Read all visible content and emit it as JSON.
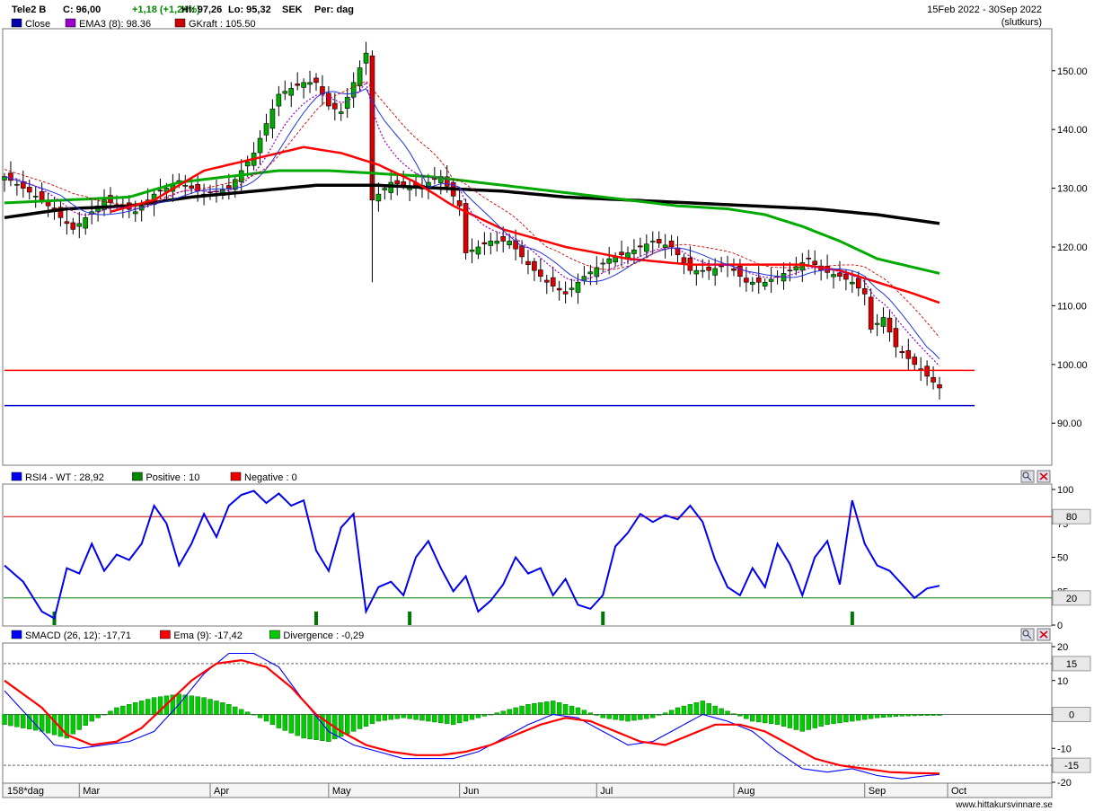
{
  "header": {
    "ticker": "Tele2 B",
    "close_label": "C: 96,00",
    "change": "+1,18 (+1,24%)",
    "high_label": "Hi: 97,26",
    "low_label": "Lo: 95,32",
    "currency": "SEK",
    "period": "Per: dag",
    "date_range": "15Feb 2022 - 30Sep 2022",
    "price_type": "(slutkurs)"
  },
  "colors": {
    "close": "#0000aa",
    "ema3": "#9900cc",
    "gkraft": "#cc0000",
    "up_candle": "#00aa00",
    "down_candle": "#dd0000",
    "ma_red": "#ff0000",
    "ma_green": "#00aa00",
    "ma_black": "#000000",
    "rsi": "#0000ee",
    "smacd": "#0000ff",
    "ema9": "#ff0000",
    "divergence": "#00cc00"
  },
  "footer": {
    "period_label": "158*dag",
    "website": "www.hittakursvinnare.se"
  },
  "chart_data": [
    {
      "type": "candlestick",
      "legend": [
        {
          "name": "Close",
          "color": "#0000aa"
        },
        {
          "name": "EMA3 (8): 98.36",
          "color": "#9900cc"
        },
        {
          "name": "GKraft : 105.50",
          "color": "#cc0000"
        }
      ],
      "x_ticks": [
        "Mar",
        "Apr",
        "May",
        "Jun",
        "Jul",
        "Aug",
        "Sep",
        "Oct"
      ],
      "y_ticks": [
        "90.00",
        "100.00",
        "110.00",
        "120.00",
        "130.00",
        "140.00",
        "150.00"
      ],
      "ylim": [
        83,
        157
      ],
      "grid": false,
      "horizontal_lines": [
        {
          "value": 99,
          "color": "#ff0000"
        },
        {
          "value": 93,
          "color": "#0000cc"
        }
      ],
      "close_anchors": [
        [
          0,
          132
        ],
        [
          6,
          128
        ],
        [
          11,
          123
        ],
        [
          16,
          128
        ],
        [
          21,
          126
        ],
        [
          24,
          129
        ],
        [
          28,
          131
        ],
        [
          32,
          129
        ],
        [
          36,
          130
        ],
        [
          40,
          136
        ],
        [
          44,
          146
        ],
        [
          48,
          148
        ],
        [
          50,
          148
        ],
        [
          52,
          144
        ],
        [
          54,
          143
        ],
        [
          56,
          148
        ],
        [
          58,
          153
        ],
        [
          59,
          128
        ],
        [
          62,
          131
        ],
        [
          66,
          130
        ],
        [
          70,
          132
        ],
        [
          73,
          127
        ],
        [
          74,
          119
        ],
        [
          78,
          121
        ],
        [
          81,
          121
        ],
        [
          84,
          117
        ],
        [
          87,
          114
        ],
        [
          90,
          112
        ],
        [
          93,
          115
        ],
        [
          97,
          118
        ],
        [
          100,
          119
        ],
        [
          104,
          121
        ],
        [
          107,
          120
        ],
        [
          110,
          116
        ],
        [
          113,
          116
        ],
        [
          116,
          117
        ],
        [
          119,
          114
        ],
        [
          122,
          114
        ],
        [
          126,
          116
        ],
        [
          129,
          118
        ],
        [
          131,
          116
        ],
        [
          134,
          115
        ],
        [
          136,
          114
        ],
        [
          138,
          112
        ],
        [
          139,
          106
        ],
        [
          141,
          108
        ],
        [
          143,
          103
        ],
        [
          145,
          101
        ],
        [
          147,
          99
        ],
        [
          149,
          97
        ],
        [
          150,
          96
        ]
      ],
      "ma_red": [
        [
          17,
          126
        ],
        [
          24,
          128
        ],
        [
          32,
          133
        ],
        [
          40,
          135
        ],
        [
          48,
          137
        ],
        [
          54,
          136
        ],
        [
          60,
          134
        ],
        [
          66,
          131
        ],
        [
          72,
          127
        ],
        [
          80,
          123
        ],
        [
          90,
          120
        ],
        [
          100,
          118
        ],
        [
          110,
          117
        ],
        [
          120,
          117
        ],
        [
          128,
          117
        ],
        [
          134,
          116
        ],
        [
          140,
          114
        ],
        [
          146,
          112
        ],
        [
          150,
          110.5
        ]
      ],
      "ma_green": [
        [
          0,
          127.5
        ],
        [
          10,
          128
        ],
        [
          20,
          128.5
        ],
        [
          28,
          131
        ],
        [
          36,
          132
        ],
        [
          44,
          133
        ],
        [
          52,
          133
        ],
        [
          60,
          132.5
        ],
        [
          68,
          132
        ],
        [
          76,
          131
        ],
        [
          84,
          130
        ],
        [
          92,
          129
        ],
        [
          100,
          128
        ],
        [
          108,
          127
        ],
        [
          116,
          126.5
        ],
        [
          122,
          125.5
        ],
        [
          128,
          123.5
        ],
        [
          134,
          121
        ],
        [
          140,
          118
        ],
        [
          146,
          116.5
        ],
        [
          150,
          115.5
        ]
      ],
      "ma_black": [
        [
          0,
          125
        ],
        [
          10,
          126.5
        ],
        [
          20,
          127
        ],
        [
          30,
          128.5
        ],
        [
          40,
          129.5
        ],
        [
          50,
          130.5
        ],
        [
          60,
          130.5
        ],
        [
          70,
          130
        ],
        [
          80,
          129.5
        ],
        [
          90,
          128.5
        ],
        [
          100,
          128
        ],
        [
          110,
          127.5
        ],
        [
          120,
          127
        ],
        [
          130,
          126.5
        ],
        [
          140,
          125.5
        ],
        [
          150,
          124
        ]
      ]
    },
    {
      "type": "line",
      "legend": [
        {
          "name": "RSI4 - WT : 28,92",
          "color": "#0000ee"
        },
        {
          "name": "Positive : 10",
          "color": "#008800"
        },
        {
          "name": "Negative : 0",
          "color": "#ee0000"
        }
      ],
      "y_ticks": [
        "0",
        "25",
        "50",
        "75",
        "100"
      ],
      "ylim": [
        0,
        100
      ],
      "reference_levels": [
        {
          "value": 80,
          "label": "80",
          "color": "#cc0000"
        },
        {
          "value": 20,
          "label": "20",
          "color": "#007700"
        }
      ],
      "rsi": [
        [
          0,
          44
        ],
        [
          3,
          32
        ],
        [
          6,
          10
        ],
        [
          8,
          5
        ],
        [
          10,
          42
        ],
        [
          12,
          38
        ],
        [
          14,
          60
        ],
        [
          16,
          40
        ],
        [
          18,
          52
        ],
        [
          20,
          48
        ],
        [
          22,
          60
        ],
        [
          24,
          88
        ],
        [
          26,
          75
        ],
        [
          28,
          44
        ],
        [
          30,
          60
        ],
        [
          32,
          82
        ],
        [
          34,
          65
        ],
        [
          36,
          88
        ],
        [
          38,
          96
        ],
        [
          40,
          99
        ],
        [
          42,
          90
        ],
        [
          44,
          97
        ],
        [
          46,
          88
        ],
        [
          48,
          92
        ],
        [
          50,
          55
        ],
        [
          52,
          40
        ],
        [
          54,
          72
        ],
        [
          56,
          82
        ],
        [
          58,
          10
        ],
        [
          60,
          28
        ],
        [
          62,
          32
        ],
        [
          64,
          22
        ],
        [
          66,
          50
        ],
        [
          68,
          62
        ],
        [
          70,
          42
        ],
        [
          72,
          25
        ],
        [
          74,
          36
        ],
        [
          76,
          10
        ],
        [
          78,
          18
        ],
        [
          80,
          30
        ],
        [
          82,
          50
        ],
        [
          84,
          38
        ],
        [
          86,
          42
        ],
        [
          88,
          22
        ],
        [
          90,
          34
        ],
        [
          92,
          15
        ],
        [
          94,
          12
        ],
        [
          96,
          22
        ],
        [
          98,
          58
        ],
        [
          100,
          68
        ],
        [
          102,
          82
        ],
        [
          104,
          76
        ],
        [
          106,
          81
        ],
        [
          108,
          78
        ],
        [
          110,
          88
        ],
        [
          112,
          76
        ],
        [
          114,
          48
        ],
        [
          116,
          28
        ],
        [
          118,
          22
        ],
        [
          120,
          42
        ],
        [
          122,
          28
        ],
        [
          124,
          60
        ],
        [
          126,
          45
        ],
        [
          128,
          22
        ],
        [
          130,
          50
        ],
        [
          132,
          62
        ],
        [
          134,
          30
        ],
        [
          136,
          92
        ],
        [
          138,
          60
        ],
        [
          140,
          44
        ],
        [
          142,
          40
        ],
        [
          144,
          30
        ],
        [
          146,
          20
        ],
        [
          148,
          27
        ],
        [
          150,
          29
        ]
      ],
      "positive_bars": [
        8,
        50,
        65,
        96,
        136
      ]
    },
    {
      "type": "line",
      "legend": [
        {
          "name": "SMACD (26, 12): -17,71",
          "color": "#0000ff"
        },
        {
          "name": "Ema (9): -17,42",
          "color": "#ff0000"
        },
        {
          "name": "Divergence : -0,29",
          "color": "#00cc00"
        }
      ],
      "y_ticks": [
        "-20",
        "-10",
        "0",
        "10",
        "20"
      ],
      "ylim": [
        -20,
        20
      ],
      "reference_levels": [
        {
          "value": 15,
          "label": "15"
        },
        {
          "value": 0,
          "label": "0"
        },
        {
          "value": -15,
          "label": "-15"
        }
      ],
      "smacd": [
        [
          0,
          7
        ],
        [
          4,
          -1
        ],
        [
          8,
          -9
        ],
        [
          12,
          -10
        ],
        [
          16,
          -9
        ],
        [
          20,
          -8
        ],
        [
          24,
          -5
        ],
        [
          28,
          3
        ],
        [
          32,
          12
        ],
        [
          36,
          18
        ],
        [
          40,
          18
        ],
        [
          44,
          14
        ],
        [
          48,
          4
        ],
        [
          52,
          -5
        ],
        [
          56,
          -9
        ],
        [
          60,
          -11
        ],
        [
          64,
          -13
        ],
        [
          68,
          -13
        ],
        [
          72,
          -13
        ],
        [
          76,
          -11
        ],
        [
          80,
          -7
        ],
        [
          84,
          -3
        ],
        [
          88,
          0
        ],
        [
          92,
          -1
        ],
        [
          96,
          -5
        ],
        [
          100,
          -9
        ],
        [
          104,
          -8
        ],
        [
          108,
          -4
        ],
        [
          112,
          0
        ],
        [
          116,
          -2
        ],
        [
          120,
          -5
        ],
        [
          124,
          -11
        ],
        [
          128,
          -16
        ],
        [
          132,
          -17
        ],
        [
          136,
          -16
        ],
        [
          140,
          -18
        ],
        [
          144,
          -19
        ],
        [
          148,
          -18
        ],
        [
          150,
          -17.7
        ]
      ],
      "ema9": [
        [
          0,
          10
        ],
        [
          6,
          2
        ],
        [
          10,
          -6
        ],
        [
          14,
          -9
        ],
        [
          18,
          -8
        ],
        [
          22,
          -4
        ],
        [
          26,
          3
        ],
        [
          30,
          10
        ],
        [
          34,
          15
        ],
        [
          38,
          16
        ],
        [
          42,
          14
        ],
        [
          46,
          8
        ],
        [
          50,
          0
        ],
        [
          54,
          -5
        ],
        [
          58,
          -9
        ],
        [
          62,
          -11
        ],
        [
          66,
          -12
        ],
        [
          70,
          -12
        ],
        [
          74,
          -11
        ],
        [
          78,
          -9
        ],
        [
          82,
          -6
        ],
        [
          86,
          -3
        ],
        [
          90,
          -1
        ],
        [
          94,
          -2
        ],
        [
          98,
          -5
        ],
        [
          102,
          -8
        ],
        [
          106,
          -9
        ],
        [
          110,
          -6
        ],
        [
          114,
          -3
        ],
        [
          118,
          -3
        ],
        [
          122,
          -5
        ],
        [
          126,
          -9
        ],
        [
          130,
          -13
        ],
        [
          134,
          -15
        ],
        [
          138,
          -16
        ],
        [
          142,
          -17
        ],
        [
          146,
          -17.3
        ],
        [
          150,
          -17.42
        ]
      ],
      "divergence": [
        [
          0,
          -3
        ],
        [
          6,
          -5
        ],
        [
          10,
          -7
        ],
        [
          14,
          -2
        ],
        [
          18,
          2
        ],
        [
          22,
          4
        ],
        [
          24,
          5
        ],
        [
          28,
          6
        ],
        [
          32,
          5
        ],
        [
          36,
          3
        ],
        [
          40,
          0
        ],
        [
          44,
          -4
        ],
        [
          48,
          -7
        ],
        [
          52,
          -8
        ],
        [
          56,
          -5
        ],
        [
          60,
          -2
        ],
        [
          64,
          -1
        ],
        [
          68,
          -2
        ],
        [
          72,
          -3
        ],
        [
          76,
          -1
        ],
        [
          80,
          1
        ],
        [
          84,
          3
        ],
        [
          88,
          4
        ],
        [
          92,
          2
        ],
        [
          96,
          -1
        ],
        [
          100,
          -2
        ],
        [
          104,
          -1
        ],
        [
          108,
          2
        ],
        [
          112,
          4
        ],
        [
          116,
          1
        ],
        [
          120,
          -2
        ],
        [
          124,
          -3
        ],
        [
          128,
          -5
        ],
        [
          132,
          -3
        ],
        [
          136,
          -2
        ],
        [
          140,
          -1
        ],
        [
          144,
          -0.5
        ],
        [
          148,
          -0.3
        ],
        [
          150,
          -0.29
        ]
      ]
    }
  ]
}
